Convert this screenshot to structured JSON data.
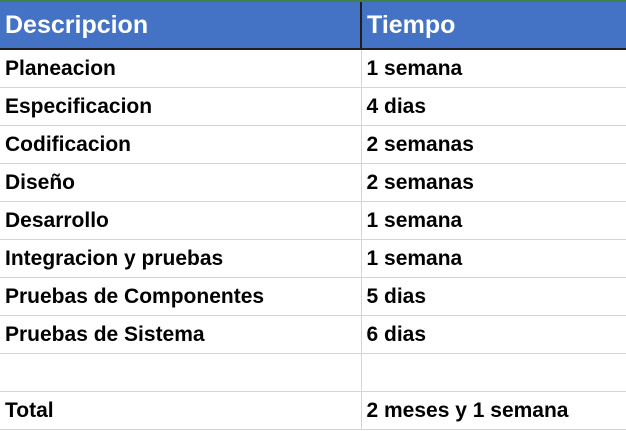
{
  "header": {
    "col_description": "Descripcion",
    "col_time": "Tiempo"
  },
  "rows": [
    {
      "description": "Planeacion",
      "time": "1 semana"
    },
    {
      "description": "Especificacion",
      "time": "4 dias"
    },
    {
      "description": "Codificacion",
      "time": "2 semanas"
    },
    {
      "description": "Diseño",
      "time": "2 semanas"
    },
    {
      "description": "Desarrollo",
      "time": "1 semana"
    },
    {
      "description": "Integracion y pruebas",
      "time": "1 semana"
    },
    {
      "description": "Pruebas de Componentes",
      "time": "5 dias"
    },
    {
      "description": "Pruebas de Sistema",
      "time": "6 dias"
    },
    {
      "description": "",
      "time": ""
    }
  ],
  "total": {
    "label": "Total",
    "value": "2 meses y  1 semana"
  },
  "colors": {
    "header_fill": "#4472c4",
    "header_text": "#ffffff",
    "grid_line": "#d4d4d4",
    "top_accent": "#3f7f48"
  }
}
